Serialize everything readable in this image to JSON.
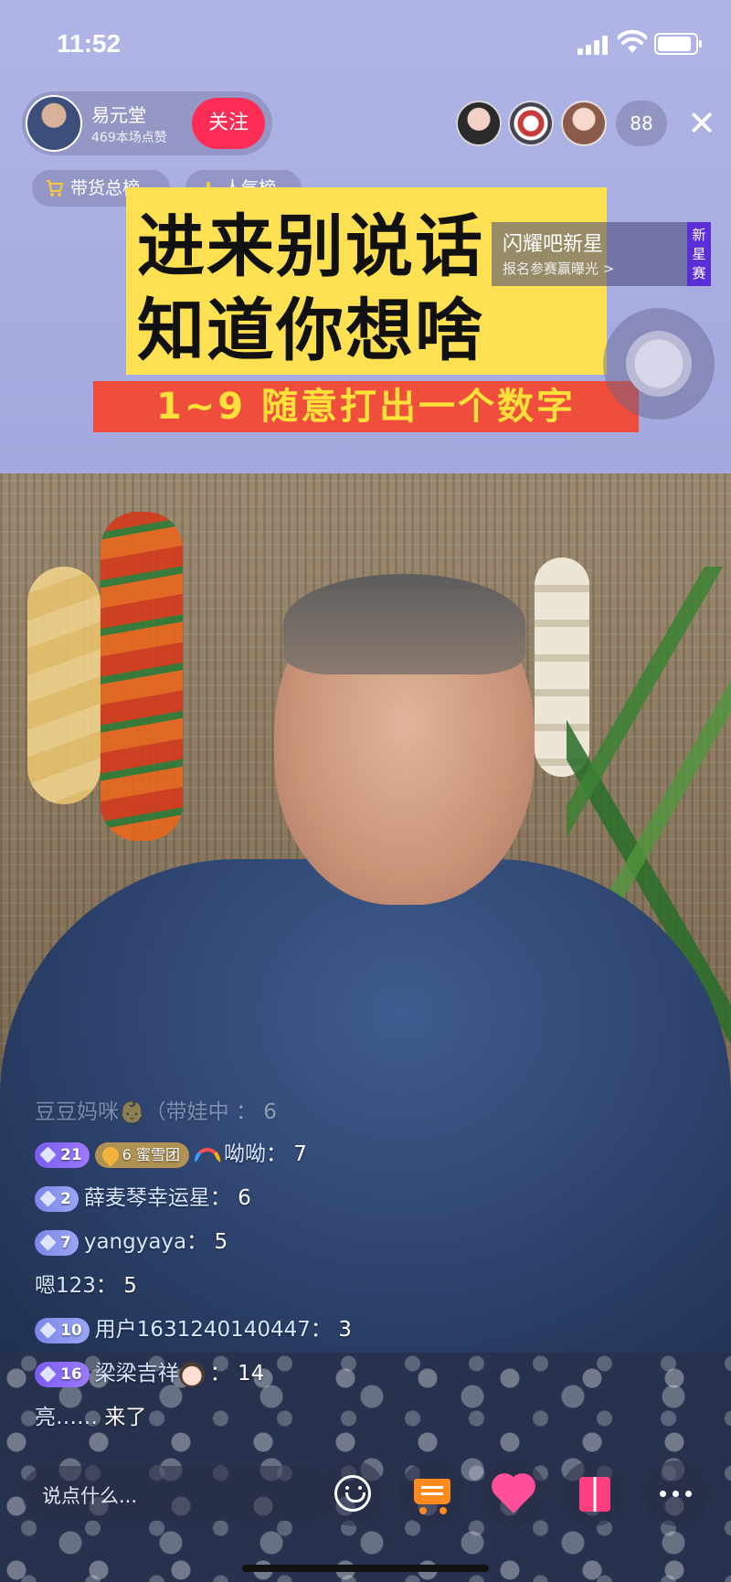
{
  "status_bar": {
    "time": "11:52"
  },
  "host": {
    "name": "易元堂",
    "likes": "469本场点赞",
    "follow_label": "关注"
  },
  "viewers": {
    "count": "88"
  },
  "ranks": {
    "goods": "带货总榜",
    "popularity": "人气榜"
  },
  "banner": {
    "line1": "进来别说话",
    "line2": "知道你想啥",
    "sub": "1~9 随意打出一个数字"
  },
  "promo": {
    "title": "闪耀吧新星",
    "subtitle": "报名参赛赢曝光 >",
    "tag": [
      "新",
      "星",
      "赛"
    ]
  },
  "comments": [
    {
      "name": "豆豆妈咪👶（带娃中",
      "text": "6",
      "faded": true
    },
    {
      "level": "21",
      "fan_badge": "蜜雪团",
      "fan_level": "6",
      "name": "呦呦",
      "text": "7"
    },
    {
      "level": "2",
      "name": "薛麦琴幸运星",
      "text": "6"
    },
    {
      "level": "7",
      "name": "yangyaya",
      "text": "5"
    },
    {
      "name": "嗯123",
      "text": "5"
    },
    {
      "level": "10",
      "name": "用户1631240140447",
      "text": "3"
    },
    {
      "level": "16",
      "name": "梁梁吉祥",
      "text": "14"
    },
    {
      "name": "亮……",
      "text": "来了"
    }
  ],
  "input": {
    "placeholder": "说点什么..."
  },
  "colors": {
    "follow": "#ff2c55",
    "banner_yellow": "#fde152",
    "banner_red": "#f04e3c",
    "level_badge": "#7b86e8",
    "promo_tag": "#5a2fd8"
  },
  "icons": [
    "signal-icon",
    "wifi-icon",
    "battery-icon",
    "close-icon",
    "cart-icon",
    "bar-chart-icon",
    "smile-icon",
    "shopping-cart-icon",
    "heart-icon",
    "gift-icon",
    "more-icon"
  ]
}
